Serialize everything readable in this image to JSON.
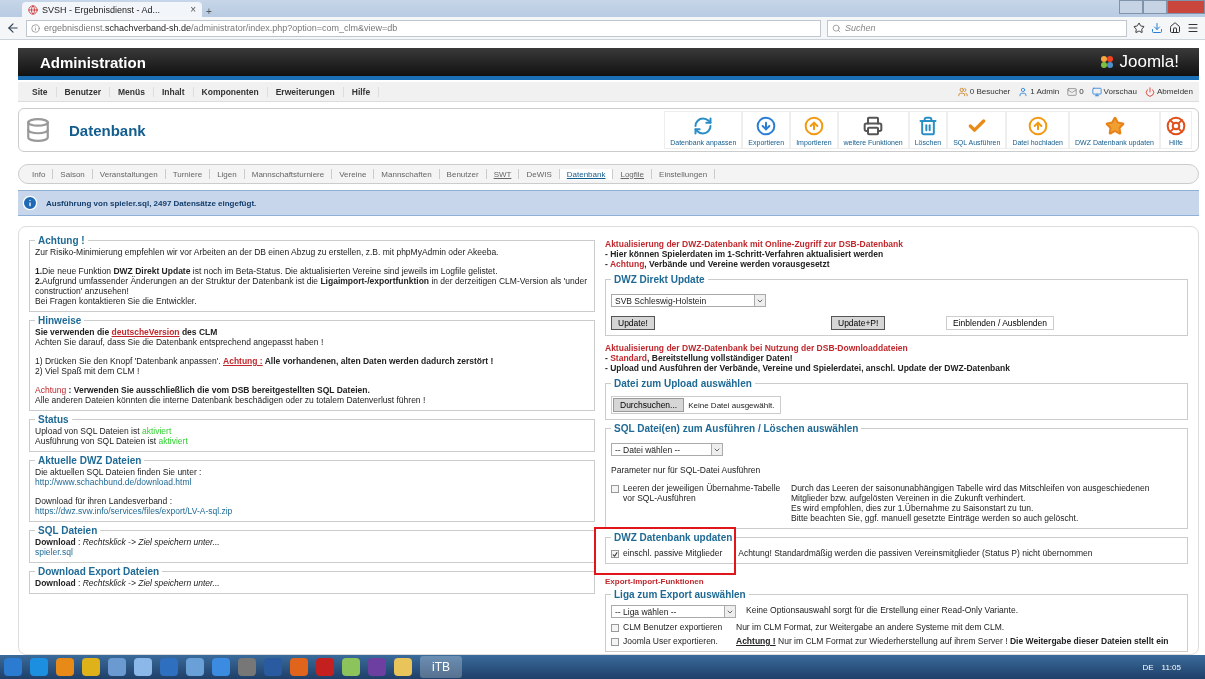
{
  "browser": {
    "tab_title": "SVSH - Ergebnisdienst - Ad...",
    "tab_close": "×",
    "new_tab": "+",
    "url": "ergebnisdienst.**schachverband-sh.de**/administrator/index.php?option=com_clm&view=db",
    "search_placeholder": "Suchen"
  },
  "header": {
    "title": "Administration",
    "logo": "Joomla!"
  },
  "menu": {
    "items": [
      "Site",
      "Benutzer",
      "Menüs",
      "Inhalt",
      "Komponenten",
      "Erweiterungen",
      "Hilfe"
    ],
    "status": [
      "0 Besucher",
      "1 Admin",
      "0",
      "Vorschau",
      "Abmelden"
    ]
  },
  "toolbar": {
    "title": "Datenbank",
    "buttons": [
      "Datenbank anpassen",
      "Exportieren",
      "Importieren",
      "weitere Funktionen",
      "Löschen",
      "SQL Ausführen",
      "Datei hochladen",
      "DWZ Datenbank updaten",
      "Hilfe"
    ]
  },
  "subnav": [
    {
      "label": "Info",
      "selected": false,
      "underlined": false
    },
    {
      "label": "Saison",
      "selected": false,
      "underlined": false
    },
    {
      "label": "Veranstaltungen",
      "selected": false,
      "underlined": false
    },
    {
      "label": "Turniere",
      "selected": false,
      "underlined": false
    },
    {
      "label": "Ligen",
      "selected": false,
      "underlined": false
    },
    {
      "label": "Mannschaftsturniere",
      "selected": false,
      "underlined": false
    },
    {
      "label": "Vereine",
      "selected": false,
      "underlined": false
    },
    {
      "label": "Mannschaften",
      "selected": false,
      "underlined": false
    },
    {
      "label": "Benutzer",
      "selected": false,
      "underlined": false
    },
    {
      "label": "SWT",
      "selected": false,
      "underlined": true
    },
    {
      "label": "DeWIS",
      "selected": false,
      "underlined": false
    },
    {
      "label": "Datenbank",
      "selected": true,
      "underlined": true
    },
    {
      "label": "Logfile",
      "selected": false,
      "underlined": true
    },
    {
      "label": "Einstellungen",
      "selected": false,
      "underlined": false
    }
  ],
  "message": "Ausführung von spieler.sql, 2497 Datensätze eingefügt.",
  "left_sections": [
    {
      "legend": "Achtung !",
      "paragraphs": [
        [
          [
            {
              "kind": "text",
              "text": "Zur Risiko-Minimierung empfehlen wir vor Arbeiten an der DB einen Abzug zu erstellen, z.B. mit phpMyAdmin oder Akeeba."
            }
          ]
        ],
        [
          [
            {
              "kind": "text",
              "text": "**1.**Die neue Funktion **DWZ Direkt Update** ist noch im Beta-Status. Die aktualisierten Vereine sind jeweils im Logfile gelistet."
            }
          ],
          [
            {
              "kind": "text",
              "text": "**2.**Aufgrund umfassender Änderungen an der Struktur der Datenbank ist die **Ligaimport-/exportfunktion** in der derzeitigen CLM-Version als 'under construction' anzusehen!"
            }
          ],
          [
            {
              "kind": "text",
              "text": "Bei Fragen kontaktieren Sie die Entwickler."
            }
          ]
        ]
      ]
    },
    {
      "legend": "Hinweise",
      "paragraphs": [
        [
          [
            {
              "kind": "bold",
              "text": "Sie verwenden die "
            },
            {
              "kind": "red-link",
              "text": "deutscheVersion"
            },
            {
              "kind": "bold",
              "text": " des CLM"
            }
          ],
          [
            {
              "kind": "text",
              "text": "Achten Sie darauf, dass Sie die Datenbank entsprechend angepasst haben !"
            }
          ]
        ],
        [
          [
            {
              "kind": "text",
              "text": "1) Drücken Sie den Knopf 'Datenbank anpassen'. "
            },
            {
              "kind": "red-link",
              "text": "Achtung :"
            },
            {
              "kind": "bold",
              "text": " Alle vorhandenen, alten Daten werden dadurch zerstört !"
            }
          ],
          [
            {
              "kind": "text",
              "text": "2) Viel Spaß mit dem CLM !"
            }
          ]
        ],
        [
          [
            {
              "kind": "red",
              "text": "Achtung"
            },
            {
              "kind": "bold",
              "text": " : Verwenden Sie ausschließlich die vom DSB bereitgestellten SQL Dateien."
            }
          ],
          [
            {
              "kind": "text",
              "text": "Alle anderen Dateien könnten die interne Datenbank beschädigen oder zu totalem Datenverlust führen !"
            }
          ]
        ]
      ]
    },
    {
      "legend": "Status",
      "paragraphs": [
        [
          [
            {
              "kind": "text",
              "text": "Upload von SQL Dateien ist "
            },
            {
              "kind": "green",
              "text": "aktiviert"
            }
          ],
          [
            {
              "kind": "text",
              "text": "Ausführung von SQL Dateien ist "
            },
            {
              "kind": "green",
              "text": "aktiviert"
            }
          ]
        ]
      ]
    },
    {
      "legend": "Aktuelle DWZ Dateien",
      "paragraphs": [
        [
          [
            {
              "kind": "text",
              "text": "Die aktuellen SQL Dateien finden Sie unter :"
            }
          ],
          [
            {
              "kind": "link",
              "text": "http://www.schachbund.de/download.html"
            }
          ]
        ],
        [
          [
            {
              "kind": "text",
              "text": "Download für ihren Landesverband :"
            }
          ],
          [
            {
              "kind": "link",
              "text": "https://dwz.svw.info/services/files/export/LV-A-sql.zip"
            }
          ]
        ]
      ]
    },
    {
      "legend": "SQL Dateien",
      "paragraphs": [
        [
          [
            {
              "kind": "bold",
              "text": "Download"
            },
            {
              "kind": "text",
              "text": " : "
            },
            {
              "kind": "italic",
              "text": "Rechtsklick -> Ziel speichern unter..."
            }
          ],
          [
            {
              "kind": "link",
              "text": "spieler.sql"
            }
          ]
        ]
      ]
    },
    {
      "legend": "Download Export Dateien",
      "paragraphs": [
        [
          [
            {
              "kind": "bold",
              "text": "Download"
            },
            {
              "kind": "text",
              "text": " : "
            },
            {
              "kind": "italic",
              "text": "Rechtsklick -> Ziel speichern unter..."
            }
          ]
        ]
      ]
    }
  ],
  "right_blocks": [
    {
      "kind": "notice",
      "lines": [
        [
          {
            "kind": "red-bold",
            "text": "Aktualisierung der DWZ-Datenbank mit Online-Zugriff zur DSB-Datenbank"
          }
        ],
        [
          {
            "kind": "bold",
            "text": "- Hier können Spielerdaten im 1-Schritt-Verfahren aktualisiert werden"
          }
        ],
        [
          {
            "kind": "bold",
            "text": "- "
          },
          {
            "kind": "red-bold",
            "text": "Achtung"
          },
          {
            "kind": "bold",
            "text": ", Verbände und Vereine werden vorausgesetzt"
          }
        ]
      ]
    },
    {
      "kind": "fieldset",
      "legend": "DWZ Direkt Update",
      "highlighted": false,
      "items": [
        {
          "kind": "select",
          "value": "SVB Schleswig-Holstein"
        },
        {
          "kind": "buttons",
          "buttons": [
            {
              "kind": "grey",
              "label": "Update!"
            },
            {
              "kind": "grey",
              "label": "Update+P!"
            },
            {
              "kind": "plain",
              "label": "Einblenden / Ausblenden"
            }
          ]
        }
      ]
    },
    {
      "kind": "notice",
      "lines": [
        [
          {
            "kind": "red-bold",
            "text": "Aktualisierung der DWZ-Datenbank bei Nutzung der DSB-Downloaddateien"
          }
        ],
        [
          {
            "kind": "bold",
            "text": "- "
          },
          {
            "kind": "red-bold",
            "text": "Standard"
          },
          {
            "kind": "bold",
            "text": ", Bereitstellung vollständiger Daten!"
          }
        ],
        [
          {
            "kind": "bold",
            "text": "- Upload und Ausführen der Verbände, Vereine und Spielerdatei, anschl. Update der DWZ-Datenbank"
          }
        ]
      ]
    },
    {
      "kind": "fieldset",
      "legend": "Datei zum Upload auswählen",
      "highlighted": false,
      "items": [
        {
          "kind": "file",
          "button": "Durchsuchen...",
          "status": "Keine Datei ausgewählt."
        }
      ]
    },
    {
      "kind": "fieldset",
      "legend": "SQL Datei(en) zum Ausführen / Löschen auswählen",
      "highlighted": false,
      "items": [
        {
          "kind": "select",
          "value": "-- Datei wählen --"
        },
        {
          "kind": "text",
          "text": "Parameter nur für SQL-Datei Ausführen"
        },
        {
          "kind": "option",
          "checked": false,
          "label": "Leeren der jeweiligen Übernahme-Tabelle vor SQL-Ausführen",
          "lines": [
            [
              {
                "kind": "text",
                "text": "Durch das Leeren der saisonunabhängigen Tabelle wird das Mitschleifen von ausgeschiedenen"
              }
            ],
            [
              {
                "kind": "text",
                "text": "Mitglieder bzw. aufgelösten Vereinen in die Zukunft verhindert."
              }
            ],
            [
              {
                "kind": "text",
                "text": "Es wird empfohlen, dies zur 1.Übernahme zu Saisonstart zu tun."
              }
            ],
            [
              {
                "kind": "text",
                "text": "Bitte beachten Sie, ggf. manuell gesetzte Einträge werden so auch gelöscht."
              }
            ]
          ]
        }
      ]
    },
    {
      "kind": "fieldset",
      "legend": "DWZ Datenbank updaten",
      "highlighted": true,
      "items": [
        {
          "kind": "inline-option",
          "checked": true,
          "label": "einschl. passive Mitglieder",
          "note": "Achtung! Standardmäßig werden die passiven Vereinsmitglieder (Status P) nicht übernommen"
        }
      ]
    },
    {
      "kind": "subheading",
      "text": "Export-Import-Funktionen"
    },
    {
      "kind": "fieldset",
      "legend": "Liga zum Export auswählen",
      "highlighted": false,
      "items": [
        {
          "kind": "select-row",
          "value": "-- Liga wählen --",
          "lines": [
            [
              {
                "kind": "text",
                "text": "Keine Optionsauswahl sorgt für die Erstellung einer Read-Only Variante."
              }
            ]
          ]
        },
        {
          "kind": "export-option",
          "checked": false,
          "label": "CLM Benutzer exportieren",
          "lines": [
            [
              {
                "kind": "text",
                "text": "Nur im CLM Format, zur Weitergabe an andere Systeme mit dem CLM."
              }
            ]
          ]
        },
        {
          "kind": "export-option",
          "checked": false,
          "label": "Joomla User exportieren.",
          "lines": [
            [
              {
                "kind": "bold-underline",
                "text": "Achtung !"
              },
              {
                "kind": "text",
                "text": " Nur im CLM Format zur Wiederherstellung auf ihrem Server ! "
              },
              {
                "kind": "bold",
                "text": "Die Weitergabe dieser Dateien stellt ein"
              }
            ]
          ]
        }
      ]
    }
  ],
  "taskbar": {
    "active_label": "iTB",
    "language": "DE",
    "time": "11:05"
  }
}
